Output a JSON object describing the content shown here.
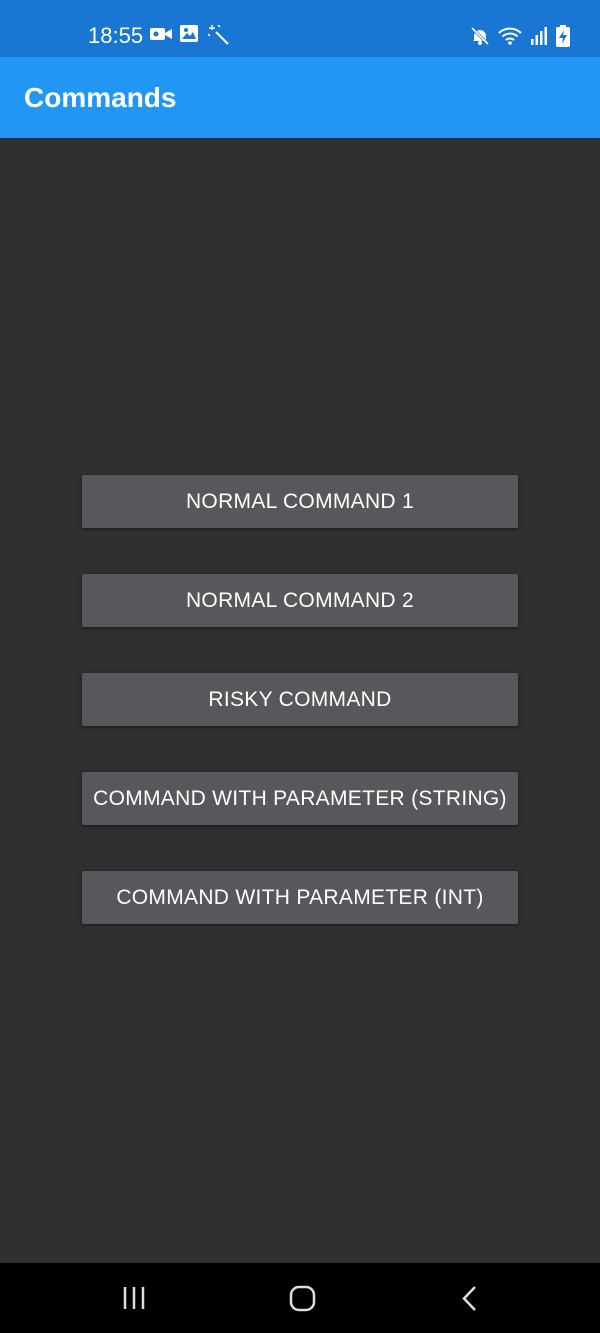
{
  "status_bar": {
    "time": "18:55",
    "left_icons": [
      "video-icon",
      "image-icon",
      "magic-wand-icon"
    ],
    "right_icons": [
      "mute-icon",
      "wifi-icon",
      "signal-icon",
      "battery-charging-icon"
    ]
  },
  "app_bar": {
    "title": "Commands"
  },
  "buttons": [
    {
      "label": "NORMAL COMMAND 1"
    },
    {
      "label": "NORMAL COMMAND 2"
    },
    {
      "label": "RISKY COMMAND"
    },
    {
      "label": "COMMAND WITH PARAMETER (STRING)"
    },
    {
      "label": "COMMAND WITH PARAMETER (INT)"
    }
  ],
  "nav_bar": {
    "items": [
      "recent-apps-icon",
      "home-icon",
      "back-icon"
    ]
  },
  "colors": {
    "status_bar": "#1976d2",
    "app_bar": "#2196f3",
    "background": "#302f32",
    "button": "#58575b"
  }
}
